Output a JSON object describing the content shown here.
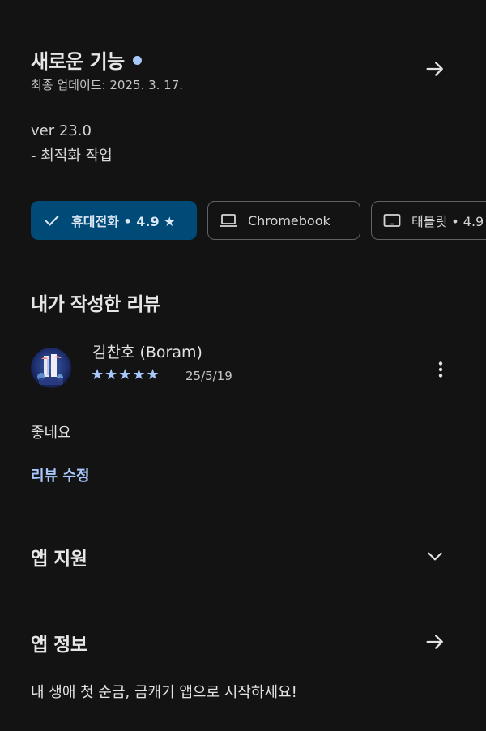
{
  "whats_new": {
    "title": "새로운 기능",
    "updated": "최종 업데이트: 2025. 3. 17.",
    "notes": [
      "ver 23.0",
      "- 최적화 작업"
    ]
  },
  "device_chips": [
    {
      "label": "휴대전화 • 4.9 ★",
      "icon": "check-icon",
      "selected": true
    },
    {
      "label": "Chromebook",
      "icon": "laptop-icon",
      "selected": false
    },
    {
      "label": "태블릿 • 4.9",
      "icon": "tablet-icon",
      "selected": false
    }
  ],
  "my_review": {
    "heading": "내가 작성한 리뷰",
    "reviewer": "김찬호 (Boram)",
    "stars": "★★★★★",
    "rating": 5,
    "date": "25/5/19",
    "text": "좋네요",
    "edit_label": "리뷰 수정"
  },
  "app_support": {
    "heading": "앱 지원"
  },
  "app_info": {
    "heading": "앱 정보",
    "description": "내 생애 첫 순금, 금캐기 앱으로 시작하세요!"
  },
  "colors": {
    "background": "#131314",
    "accent": "#a8c7fa",
    "chip_selected_bg": "#004a77",
    "chip_border": "#5f6368"
  }
}
